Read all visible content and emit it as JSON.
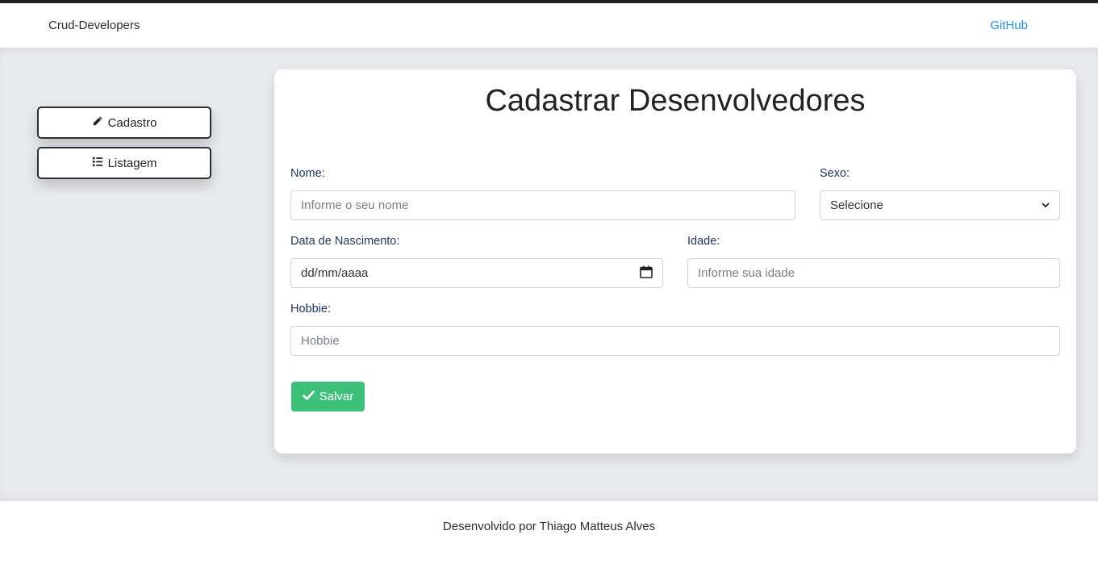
{
  "navbar": {
    "brand": "Crud-Developers",
    "github_link": "GitHub"
  },
  "sidebar": {
    "items": [
      {
        "label": "Cadastro",
        "icon": "pencil-icon"
      },
      {
        "label": "Listagem",
        "icon": "list-icon"
      }
    ]
  },
  "form": {
    "title": "Cadastrar Desenvolvedores",
    "nome": {
      "label": "Nome:",
      "placeholder": "Informe o seu nome"
    },
    "sexo": {
      "label": "Sexo:",
      "selected": "Selecione"
    },
    "data_nascimento": {
      "label": "Data de Nascimento:",
      "placeholder": "dd/mm/aaaa"
    },
    "idade": {
      "label": "Idade:",
      "placeholder": "Informe sua idade"
    },
    "hobbie": {
      "label": "Hobbie:",
      "placeholder": "Hobbie"
    },
    "save_label": "Salvar"
  },
  "footer": {
    "text": "Desenvolvido por Thiago Matteus Alves"
  },
  "colors": {
    "accent_link": "#2a8fd4",
    "save_button": "#3ec07a",
    "background": "#e9eaee"
  }
}
